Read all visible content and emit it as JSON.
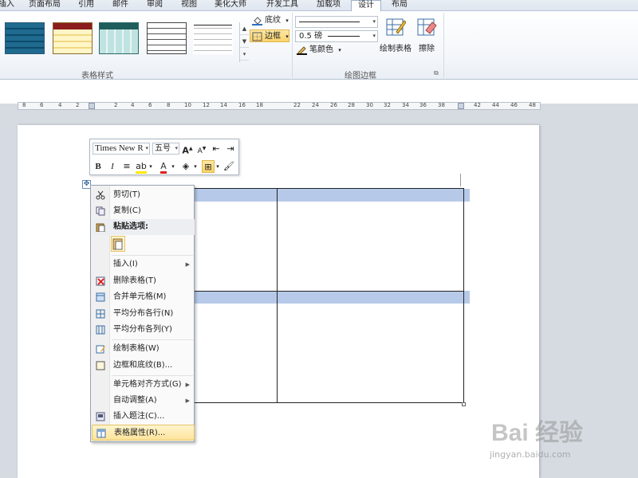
{
  "tabs": [
    "插入",
    "页面布局",
    "引用",
    "邮件",
    "审阅",
    "视图",
    "美化大师",
    "开发工具",
    "加载项",
    "设计",
    "布局"
  ],
  "active_tab": "设计",
  "ribbon": {
    "group_table_styles": "表格样式",
    "group_draw_borders": "绘图边框",
    "shading_label": "底纹",
    "borders_label": "边框",
    "line_weight": "0.5 磅",
    "pen_color_label": "笔颜色",
    "draw_table_label": "绘制表格",
    "eraser_label": "擦除"
  },
  "ruler": {
    "numbers": [
      "8",
      "6",
      "4",
      "2",
      "2",
      "4",
      "6",
      "8",
      "10",
      "12",
      "14",
      "16",
      "18",
      "22",
      "24",
      "26",
      "28",
      "30",
      "32",
      "34",
      "36",
      "38",
      "42",
      "44",
      "46",
      "48"
    ]
  },
  "mini_toolbar": {
    "font": "Times New R",
    "size": "五号",
    "bold": "B",
    "italic": "I",
    "font_color_glyph": "A"
  },
  "context_menu": {
    "items": [
      {
        "label": "剪切(T)",
        "icon": "scissors-icon"
      },
      {
        "label": "复制(C)",
        "icon": "copy-icon"
      },
      {
        "label": "粘贴选项:",
        "icon": "paste-icon"
      },
      {
        "label": "插入(I)",
        "submenu": true
      },
      {
        "label": "删除表格(T)",
        "icon": "delete-table-icon"
      },
      {
        "label": "合并单元格(M)",
        "icon": "merge-cells-icon"
      },
      {
        "label": "平均分布各行(N)",
        "icon": "distribute-rows-icon"
      },
      {
        "label": "平均分布各列(Y)",
        "icon": "distribute-columns-icon"
      },
      {
        "label": "绘制表格(W)",
        "icon": "draw-table-icon"
      },
      {
        "label": "边框和底纹(B)...",
        "icon": "borders-shading-icon"
      },
      {
        "label": "单元格对齐方式(G)",
        "submenu": true
      },
      {
        "label": "自动调整(A)",
        "submenu": true
      },
      {
        "label": "插入题注(C)...",
        "icon": "caption-icon"
      },
      {
        "label": "表格属性(R)...",
        "icon": "table-properties-icon"
      }
    ]
  },
  "watermark": {
    "brand": "Bai 经验",
    "url": "jingyan.baidu.com"
  },
  "colors": {
    "highlight_row": "#b6c9e8",
    "menu_hover": "#fde49b"
  }
}
